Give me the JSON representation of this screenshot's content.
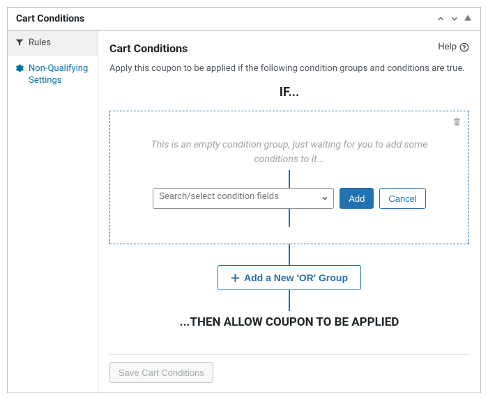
{
  "panel": {
    "title": "Cart Conditions"
  },
  "sidebar": {
    "items": [
      {
        "label": "Rules"
      },
      {
        "label": "Non-Qualifying Settings"
      }
    ]
  },
  "main": {
    "title": "Cart Conditions",
    "help_label": "Help",
    "description": "Apply this coupon to be applied if the following condition groups and conditions are true.",
    "if_label": "IF...",
    "empty_group_message": "This is an empty condition group, just waiting for you to add some conditions to it...",
    "select_placeholder": "Search/select condition fields",
    "add_btn": "Add",
    "cancel_btn": "Cancel",
    "add_or_group_btn": "Add a New 'OR' Group",
    "then_label": "...THEN ALLOW COUPON TO BE APPLIED",
    "save_btn": "Save Cart Conditions"
  }
}
